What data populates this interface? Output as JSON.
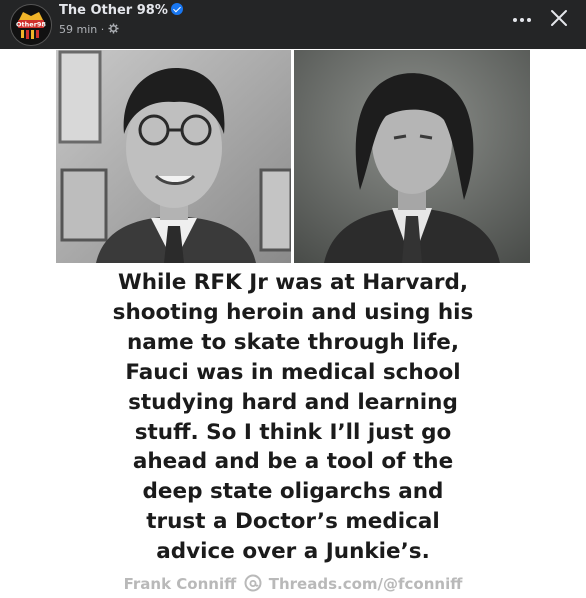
{
  "header": {
    "page_name": "The Other 98%",
    "time_label": "59 min",
    "avatar_text": "Other98"
  },
  "post": {
    "caption_lines": "While RFK Jr was at Harvard,\nshooting heroin and using his\nname to skate through life,\nFauci was in medical school\nstudying hard and learning\nstuff. So I think I’ll just go\nahead and be a tool of the\ndeep state oligarchs and\ntrust a Doctor’s medical\nadvice over a Junkie’s.",
    "credit_name": "Frank Conniff",
    "credit_handle": "Threads.com/@fconniff"
  },
  "colors": {
    "topbar_bg": "#242526",
    "avatar_yellow": "#f0b429",
    "avatar_red": "#d0312d",
    "verified_blue": "#1877f2"
  },
  "icons": [
    "globe-gear-icon",
    "more-icon",
    "close-icon",
    "threads-icon",
    "verified-icon"
  ]
}
